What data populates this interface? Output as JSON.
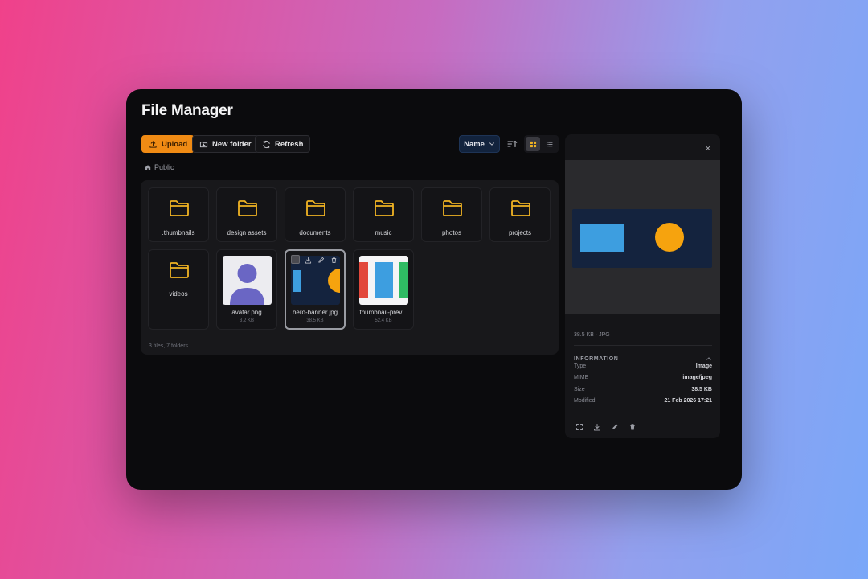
{
  "app": {
    "title": "File Manager"
  },
  "toolbar": {
    "upload_label": "Upload",
    "new_folder_label": "New folder",
    "refresh_label": "Refresh",
    "sort_value": "Name",
    "view_mode": "grid"
  },
  "breadcrumb": {
    "root": "Public"
  },
  "items": {
    "folders": [
      {
        "name": ".thumbnails"
      },
      {
        "name": "design assets"
      },
      {
        "name": "documents"
      },
      {
        "name": "music"
      },
      {
        "name": "photos"
      },
      {
        "name": "projects"
      },
      {
        "name": "videos"
      }
    ],
    "files": [
      {
        "name": "avatar.png",
        "size": "3.2 KB"
      },
      {
        "name": "hero-banner.jpg",
        "size": "38.5 KB",
        "selected": true
      },
      {
        "name": "thumbnail-prev...",
        "size": "52.4 KB"
      }
    ]
  },
  "summary": "3 files, 7 folders",
  "preview": {
    "meta": "38.5 KB · JPG",
    "info_title": "INFORMATION",
    "rows": [
      {
        "key": "Type",
        "value": "Image"
      },
      {
        "key": "MIME",
        "value": "image/jpeg"
      },
      {
        "key": "Size",
        "value": "38.5 KB"
      },
      {
        "key": "Modified",
        "value": "21 Feb 2026 17:21"
      }
    ],
    "close_label": "×"
  },
  "colors": {
    "accent": "#f08b14",
    "folder": "#f0b323",
    "panel": "#18181b",
    "banner_bg": "#14233e",
    "banner_rect": "#3d9ee0",
    "banner_circle": "#f6a30e"
  }
}
